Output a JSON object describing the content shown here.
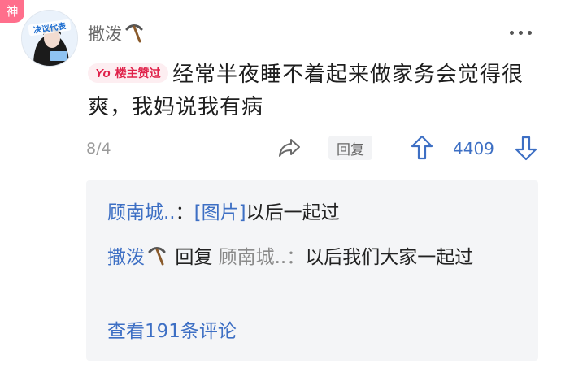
{
  "post": {
    "avatar_badge": "神",
    "avatar_sticker_text": "决议代表",
    "username": "撒泼",
    "op_badge_yo": "Yo",
    "op_badge_text": "楼主赞过",
    "content": "经常半夜睡不着起来做家务会觉得很爽，我妈说我有病",
    "date": "8/4",
    "reply_label": "回复",
    "likes": "4409"
  },
  "replies": {
    "item1": {
      "author": "顾南城..",
      "sep": "：",
      "image_tag": "[图片]",
      "text": "以后一起过"
    },
    "item2": {
      "author": "撒泼",
      "reply_word": "回复",
      "target": "顾南城..",
      "sep": "：",
      "text": "以后我们大家一起过"
    },
    "view_more": "查看191条评论"
  },
  "icons": {
    "username_emoji": "pickaxe-icon",
    "more": "more-dots-icon",
    "share": "share-icon",
    "upvote": "upvote-arrow-icon",
    "downvote": "downvote-arrow-icon"
  },
  "colors": {
    "link_blue": "#3d6fc4",
    "op_badge_red": "#e0224a",
    "god_badge_pink": "#ff6f8c"
  }
}
